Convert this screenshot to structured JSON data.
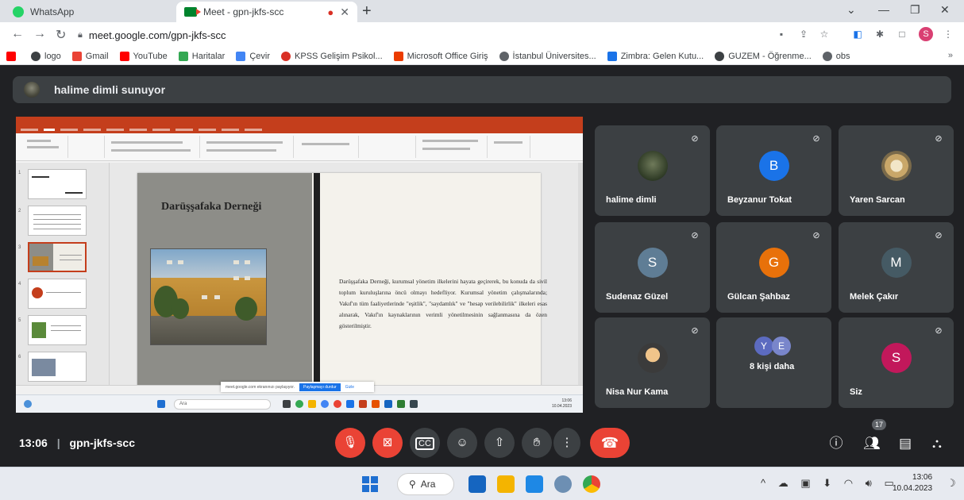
{
  "browser": {
    "tabs": [
      {
        "label": "WhatsApp",
        "active": false
      },
      {
        "label": "Meet - gpn-jkfs-scc",
        "active": true
      }
    ],
    "url": "meet.google.com/gpn-jkfs-scc",
    "profile_initial": "S",
    "bookmarks": [
      {
        "label": "logo",
        "color": "#3c4043"
      },
      {
        "label": "Gmail",
        "color": "#ea4335"
      },
      {
        "label": "YouTube",
        "color": "#ff0000"
      },
      {
        "label": "Haritalar",
        "color": "#34a853"
      },
      {
        "label": "Çevir",
        "color": "#4285f4"
      },
      {
        "label": "KPSS Gelişim Psikol...",
        "color": "#d93025"
      },
      {
        "label": "Microsoft Office Giriş",
        "color": "#eb3c00"
      },
      {
        "label": "İstanbul Üniversites...",
        "color": "#5f6368"
      },
      {
        "label": "Zimbra: Gelen Kutu...",
        "color": "#1a73e8"
      },
      {
        "label": "GUZEM - Öğrenme...",
        "color": "#3c4043"
      },
      {
        "label": "obs",
        "color": "#5f6368"
      }
    ],
    "bookmarks_more": "»"
  },
  "meet": {
    "presenter_text": "halime dimli sunuyor",
    "meeting_time": "13:06",
    "meeting_code": "gpn-jkfs-scc",
    "time_separator": "|",
    "people_count": "17",
    "participants": [
      {
        "name": "halime dimli",
        "initial": "",
        "avatar_color": "photo"
      },
      {
        "name": "Beyzanur Tokat",
        "initial": "B",
        "avatar_color": "#1a73e8"
      },
      {
        "name": "Yaren Sarcan",
        "initial": "",
        "avatar_color": "photo"
      },
      {
        "name": "Sudenaz Güzel",
        "initial": "S",
        "avatar_color": "#5f7d95"
      },
      {
        "name": "Gülcan Şahbaz",
        "initial": "G",
        "avatar_color": "#e8710a"
      },
      {
        "name": "Melek Çakır",
        "initial": "M",
        "avatar_color": "#455a64"
      },
      {
        "name": "Nisa Nur Kama",
        "initial": "",
        "avatar_color": "photo"
      },
      {
        "name": "8 kişi daha",
        "initial": "",
        "avatar_color": ""
      },
      {
        "name": "Siz",
        "initial": "S",
        "avatar_color": "#c2185b"
      }
    ],
    "more_initials": [
      "Y",
      "E"
    ],
    "more_colors": [
      "#5c6bc0",
      "#7986cb"
    ]
  },
  "presentation": {
    "slide_title": "Darüşşafaka Derneği",
    "slide_body": "Darüşşafaka Derneği, kurumsal yönetim ilkelerini hayata geçirerek, bu konuda da sivil toplum kuruluşlarına öncü olmayı hedefliyor. Kurumsal yönetim çalışmalarında; Vakıf'ın tüm faaliyetlerinde \"eşitlik\", \"saydamlık\" ve \"hesap verilebilirlik\" ilkeleri esas alınarak, Vakıf'ın kaynaklarının verimli yönetilmesinin sağlanmasına da özen gösterilmiştir.",
    "share_banner_text": "meet.google.com ekranınızı paylaşıyor.",
    "share_stop": "Paylaşmayı durdur",
    "share_hide": "Gizle",
    "inner_search": "Ara",
    "inner_clock_time": "13:06",
    "inner_clock_date": "10.04.2023"
  },
  "taskbar": {
    "search_label": "Ara",
    "clock_time": "13:06",
    "clock_date": "10.04.2023"
  },
  "colors": {
    "meet_bg": "#202124",
    "tile_bg": "#3c4043",
    "danger": "#ea4335",
    "powerpoint": "#c43e1c"
  }
}
